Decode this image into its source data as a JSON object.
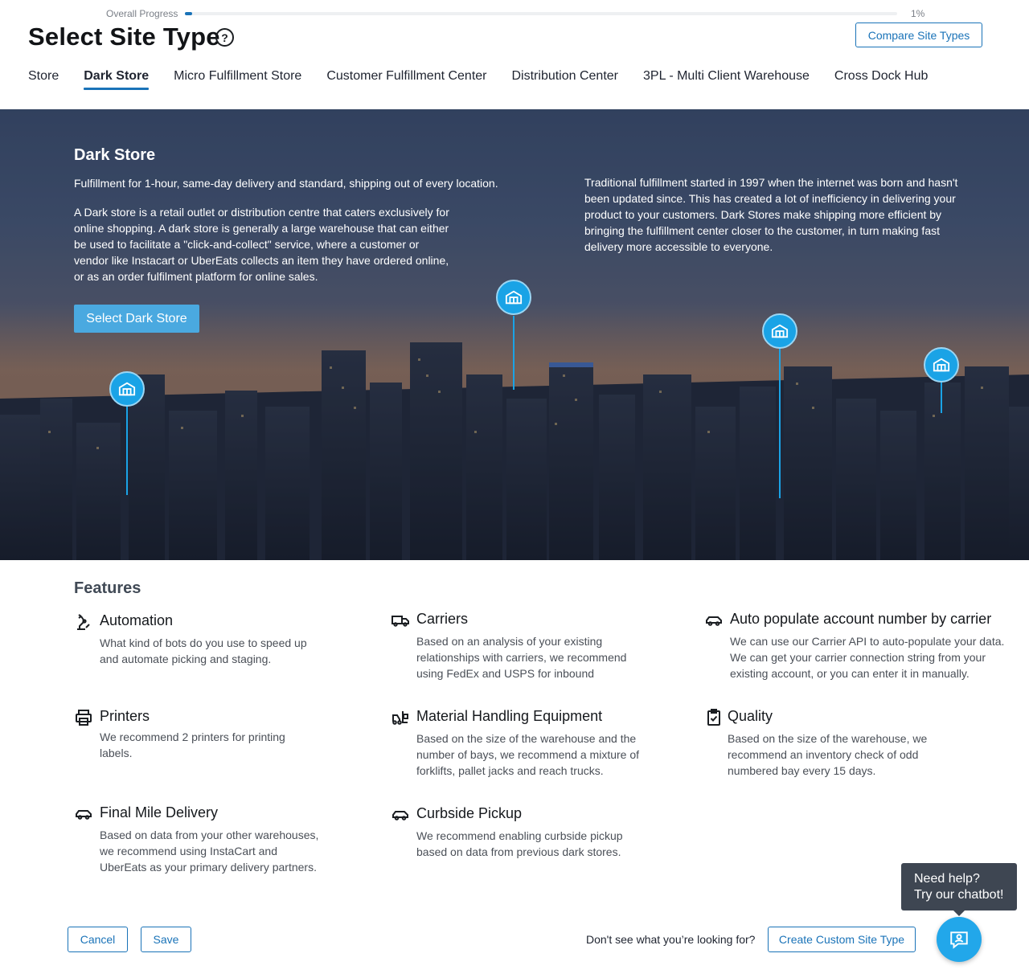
{
  "progress": {
    "label": "Overall Progress",
    "value_percent": 1,
    "display": "1%"
  },
  "header": {
    "title": "Select Site Type",
    "help_icon": "question-circle-icon",
    "compare_label": "Compare Site Types"
  },
  "tabs": [
    {
      "label": "Store",
      "active": false
    },
    {
      "label": "Dark Store",
      "active": true
    },
    {
      "label": "Micro Fulfillment Store",
      "active": false
    },
    {
      "label": "Customer Fulfillment Center",
      "active": false
    },
    {
      "label": "Distribution Center",
      "active": false
    },
    {
      "label": "3PL - Multi Client Warehouse",
      "active": false
    },
    {
      "label": "Cross Dock Hub",
      "active": false
    }
  ],
  "hero": {
    "title": "Dark Store",
    "subtitle": "Fulfillment for 1-hour, same-day delivery and standard, shipping out of every location.",
    "description": "A Dark store is a retail outlet or distribution centre that caters exclusively for online shopping. A dark store is generally a large warehouse that can either be used to facilitate a \"click-and-collect\" service, where a customer or vendor like Instacart or UberEats collects an item they have ordered online, or as an order fulfilment platform for online sales.",
    "right_text": "Traditional fulfillment started in 1997 when the internet was born and hasn't been updated since. This has created a lot of inefficiency in delivering your product to your customers. Dark Stores make shipping more efficient by bringing the fulfillment center closer to the customer, in turn making fast delivery more accessible to everyone.",
    "select_label": "Select Dark Store",
    "pin_icon": "warehouse-icon"
  },
  "features": {
    "title": "Features",
    "items": [
      {
        "icon": "robot-arm-icon",
        "title": "Automation",
        "desc": "What kind of bots do you use to speed up and automate picking and staging."
      },
      {
        "icon": "truck-icon",
        "title": "Carriers",
        "desc": "Based on an analysis of your existing relationships with carriers, we recommend using FedEx and USPS for inbound"
      },
      {
        "icon": "car-icon",
        "title": "Auto populate account number by carrier",
        "desc": "We can use our Carrier API to auto-populate your data. We can get your carrier connection string from your existing account, or you can enter it in manually."
      },
      {
        "icon": "printer-icon",
        "title": "Printers",
        "desc": "We recommend 2 printers for printing labels."
      },
      {
        "icon": "forklift-icon",
        "title": "Material Handling Equipment",
        "desc": "Based on the size of the warehouse and the number of bays, we recommend a mixture of forklifts, pallet jacks and reach trucks."
      },
      {
        "icon": "clipboard-check-icon",
        "title": "Quality",
        "desc": "Based on the size of the warehouse, we recommend an inventory check of odd numbered bay every 15 days."
      },
      {
        "icon": "car-icon",
        "title": "Final Mile Delivery",
        "desc": "Based on data from your other warehouses, we recommend using InstaCart and UberEats as your primary delivery partners."
      },
      {
        "icon": "car-icon",
        "title": "Curbside Pickup",
        "desc": "We recommend enabling curbside pickup based on data from previous dark stores."
      }
    ]
  },
  "footer": {
    "cancel_label": "Cancel",
    "save_label": "Save",
    "looking_text": "Don't see what you’re looking for?",
    "custom_label": "Create Custom Site Type"
  },
  "chat": {
    "line1": "Need help?",
    "line2": "Try our chatbot!",
    "icon": "chatbot-icon"
  },
  "colors": {
    "accent": "#1a73b8",
    "pin": "#1aa3e6",
    "select_button": "#4aa9e0",
    "chat_button": "#22a7ea"
  }
}
